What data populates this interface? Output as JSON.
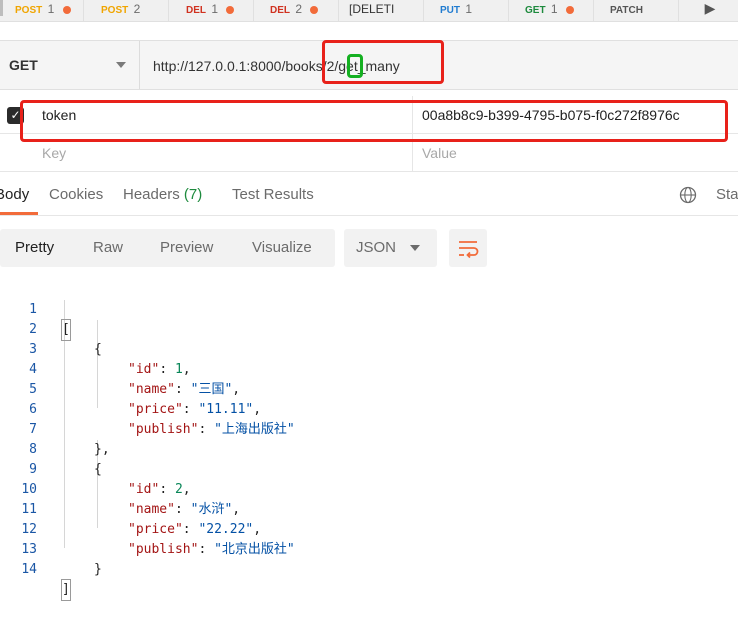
{
  "tabs": [
    {
      "method": "POST",
      "num": "1",
      "dot": true
    },
    {
      "method": "POST",
      "num": "2",
      "dot": false
    },
    {
      "method": "DEL",
      "num": "1",
      "dot": true
    },
    {
      "method": "DEL",
      "num": "2",
      "dot": true
    },
    {
      "plain": "[DELETI"
    },
    {
      "method": "PUT",
      "num": "1",
      "dot": false
    },
    {
      "method": "GET",
      "num": "1",
      "dot": true
    },
    {
      "method": "PATCH",
      "num": "",
      "dot": false
    }
  ],
  "request": {
    "method": "GET",
    "url": "http://127.0.0.1:8000/books/2/get_many"
  },
  "params": {
    "row": {
      "key": "token",
      "value": "00a8b8c9-b399-4795-b075-f0c272f8976c",
      "checked": true
    },
    "placeholder_key": "Key",
    "placeholder_value": "Value"
  },
  "response_tabs": {
    "body": "Body",
    "cookies": "Cookies",
    "headers": "Headers",
    "headers_count": "(7)",
    "test_results": "Test Results",
    "status_partial": "Stat"
  },
  "format_bar": {
    "pretty": "Pretty",
    "raw": "Raw",
    "preview": "Preview",
    "visualize": "Visualize",
    "language": "JSON"
  },
  "code_lines": [
    "1",
    "2",
    "3",
    "4",
    "5",
    "6",
    "7",
    "8",
    "9",
    "10",
    "11",
    "12",
    "13",
    "14"
  ],
  "json": {
    "items": [
      {
        "id": "1",
        "name": "\"三国\"",
        "price": "\"11.11\"",
        "publish": "\"上海出版社\""
      },
      {
        "id": "2",
        "name": "\"水浒\"",
        "price": "\"22.22\"",
        "publish": "\"北京出版社\""
      }
    ],
    "keys": {
      "id": "\"id\"",
      "name": "\"name\"",
      "price": "\"price\"",
      "publish": "\"publish\""
    }
  },
  "colors": {
    "accent": "#f26b3a",
    "highlight_red": "#e8211a",
    "highlight_green": "#15b022"
  }
}
